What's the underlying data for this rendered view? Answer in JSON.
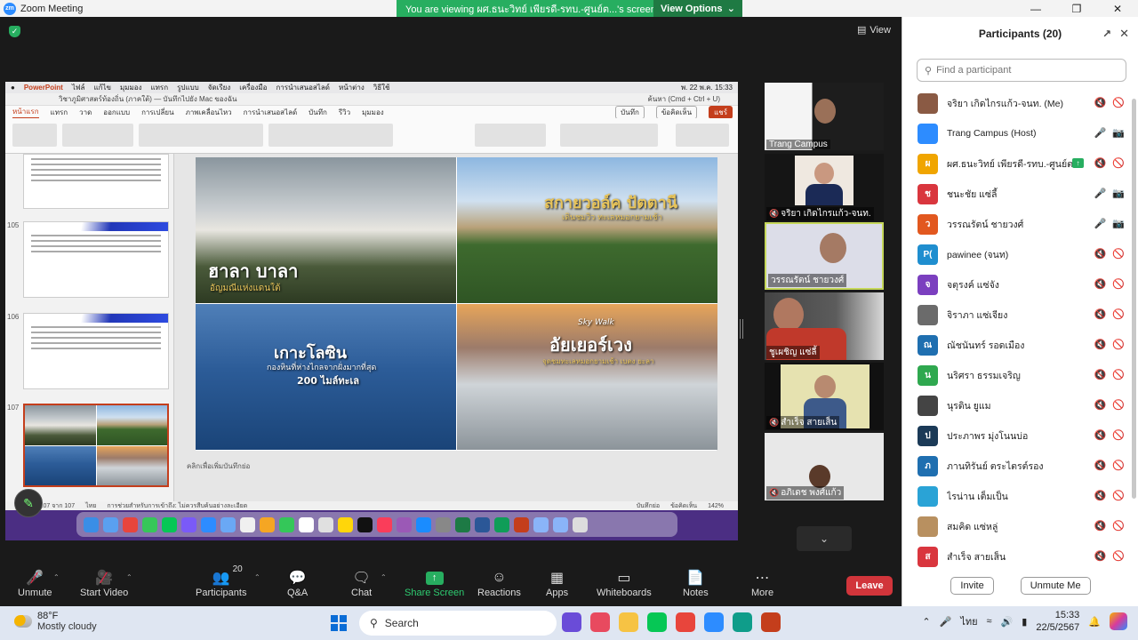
{
  "titlebar": {
    "title": "Zoom Meeting",
    "logo": "zm",
    "viewing_text": "You are viewing ผศ.ธนะวิทย์ เพียรดี-รทบ.-ศูนย์ต...'s screen",
    "view_options": "View Options",
    "chevron": "⌄"
  },
  "stage": {
    "view_label": "View",
    "view_icon": "grid-icon"
  },
  "shared": {
    "mac_menu": {
      "app": "PowerPoint",
      "items": [
        "ไฟล์",
        "แก้ไข",
        "มุมมอง",
        "แทรก",
        "รูปแบบ",
        "จัดเรียง",
        "เครื่องมือ",
        "การนำเสนอสไลด์",
        "หน้าต่าง",
        "วิธีใช้"
      ],
      "clock": "พ. 22 พ.ค.  15:33"
    },
    "ppt_title": "วิชาภูมิศาสตร์ท้องถิ่น (ภาคใต้) — บันทึกไปยัง Mac ของฉัน",
    "ppt_search": "ค้นหา (Cmd + Ctrl + U)",
    "tabs": [
      "หน้าแรก",
      "แทรก",
      "วาด",
      "ออกแบบ",
      "การเปลี่ยน",
      "ภาพเคลื่อนไหว",
      "การนำเสนอสไลด์",
      "บันทึก",
      "รีวิว",
      "มุมมอง"
    ],
    "record_btn": "บันทึก",
    "comment_btn": "ข้อคิดเห็น",
    "share_btn": "แชร์",
    "slide_nums": [
      "105",
      "106",
      "107"
    ],
    "slide": {
      "p1_title": "ฮาลา บาลา",
      "p1_sub": "อัญมณีแห่งแดนใต้",
      "p2_title": "สกายวอล์ค ปัตตานี",
      "p2_sub": "เดินชมวิว ทะเลหมอกยามเช้า",
      "p3_title": "เกาะโลซิน",
      "p3_sub": "กองหินที่ห่างไกลจากฝั่งมากที่สุด",
      "p3_sub2": "200 ไมล์ทะเล",
      "p4_tag": "Sky Walk",
      "p4_title": "อัยเยอร์เวง",
      "p4_sub": "จุดชมทะเลหมอกยามเช้า เบตง ยะลา"
    },
    "notes": "คลิกเพื่อเพิ่มบันทึกย่อ",
    "status": {
      "slide_count": "สไลด์ 107 จาก 107",
      "lang": "ไทย",
      "accessibility": "การช่วยสำหรับการเข้าถึง: ไม่ควรสืบค้นอย่างละเอียด",
      "notes_btn": "บันทึกย่อ",
      "comments_btn": "ข้อคิดเห็น",
      "zoom": "142%"
    }
  },
  "videos": [
    {
      "name": "Trang Campus",
      "muted": false
    },
    {
      "name": "จริยา เกิดไกรแก้ว-จนท.",
      "muted": true
    },
    {
      "name": "วรรณรัตน์ ชายวงศ์",
      "muted": false,
      "active": true
    },
    {
      "name": "ชูเผชิญ แซ่ลี้",
      "muted": false
    },
    {
      "name": "สำเร็จ สายเส็น",
      "muted": true
    },
    {
      "name": "อภิเดช พงศ์แก้ว",
      "muted": true
    }
  ],
  "participants": {
    "title": "Participants (20)",
    "search_placeholder": "Find a participant",
    "list": [
      {
        "name": "จริยา เกิดไกรแก้ว-จนท. (Me)",
        "initial": "",
        "color": "#8a5a44",
        "mic": "off",
        "cam": "off"
      },
      {
        "name": "Trang Campus (Host)",
        "initial": "",
        "color": "#2d8cff",
        "mic": "on",
        "cam": "on"
      },
      {
        "name": "ผศ.ธนะวิทย์ เพียรดี-รทบ.-ศูนย์ตรัง",
        "initial": "ผ",
        "color": "#f0a500",
        "mic": "off",
        "cam": "off",
        "sharing": true
      },
      {
        "name": "ชนะชัย แซ่ลี้",
        "initial": "ช",
        "color": "#d9363e",
        "mic": "on",
        "cam": "on"
      },
      {
        "name": "วรรณรัตน์ ชายวงศ์",
        "initial": "ว",
        "color": "#e2581f",
        "mic": "on",
        "cam": "on"
      },
      {
        "name": "pawinee (จนท)",
        "initial": "P(",
        "color": "#1f8ecf",
        "mic": "off",
        "cam": "off"
      },
      {
        "name": "จตุรงค์ แซ่จัง",
        "initial": "จ",
        "color": "#7b3fbf",
        "mic": "off",
        "cam": "off"
      },
      {
        "name": "จิราภา แซ่เจียง",
        "initial": "",
        "color": "#6b6b6b",
        "mic": "off",
        "cam": "off"
      },
      {
        "name": "ณัชนันทร์ รอดเมือง",
        "initial": "ณ",
        "color": "#1f6fb0",
        "mic": "off",
        "cam": "off"
      },
      {
        "name": "นริศรา ธรรมเจริญ",
        "initial": "น",
        "color": "#2fa84f",
        "mic": "off",
        "cam": "off"
      },
      {
        "name": "นุรดิน ยูแม",
        "initial": "",
        "color": "#444",
        "mic": "off",
        "cam": "off"
      },
      {
        "name": "ประภาพร มุ่งโนนบ่อ",
        "initial": "ป",
        "color": "#1b3a57",
        "mic": "off",
        "cam": "off"
      },
      {
        "name": "ภานทิรันย์ ตระไตรต์รอง",
        "initial": "ภ",
        "color": "#1f6fb0",
        "mic": "off",
        "cam": "off"
      },
      {
        "name": "ไรน่าน เต็มเป็น",
        "initial": "",
        "color": "#2aa3d6",
        "mic": "off",
        "cam": "off"
      },
      {
        "name": "สมคิด แซ่หลู่",
        "initial": "",
        "color": "#b89060",
        "mic": "off",
        "cam": "off"
      },
      {
        "name": "สำเร็จ สายเส็น",
        "initial": "ส",
        "color": "#d9363e",
        "mic": "off",
        "cam": "off"
      }
    ],
    "invite": "Invite",
    "unmute_me": "Unmute Me"
  },
  "toolbar": {
    "unmute": "Unmute",
    "start_video": "Start Video",
    "participants": "Participants",
    "participants_count": "20",
    "qa": "Q&A",
    "chat": "Chat",
    "share_screen": "Share Screen",
    "reactions": "Reactions",
    "apps": "Apps",
    "whiteboards": "Whiteboards",
    "notes": "Notes",
    "more": "More",
    "leave": "Leave"
  },
  "taskbar": {
    "temp": "88°F",
    "weather": "Mostly cloudy",
    "search": "Search",
    "lang": "ไทย",
    "time": "15:33",
    "date": "22/5/2567"
  }
}
